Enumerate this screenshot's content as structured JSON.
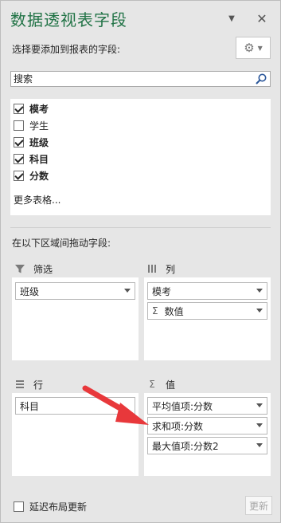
{
  "pane": {
    "title": "数据透视表字段",
    "subtitle": "选择要添加到报表的字段:",
    "title_color": "#217346"
  },
  "search": {
    "placeholder": "搜索"
  },
  "fields": [
    {
      "label": "模考",
      "checked": true,
      "bold": true
    },
    {
      "label": "学生",
      "checked": false,
      "bold": false
    },
    {
      "label": "班级",
      "checked": true,
      "bold": true
    },
    {
      "label": "科目",
      "checked": true,
      "bold": true
    },
    {
      "label": "分数",
      "checked": true,
      "bold": true
    }
  ],
  "more_tables": "更多表格...",
  "drag_hint": "在以下区域间拖动字段:",
  "areas": {
    "filter": {
      "title": "筛选",
      "items": [
        "班级"
      ]
    },
    "columns": {
      "title": "列",
      "items": [
        "模考",
        "数值"
      ]
    },
    "rows": {
      "title": "行",
      "items": [
        "科目"
      ]
    },
    "values": {
      "title": "值",
      "items": [
        "平均值项:分数",
        "求和项:分数",
        "最大值项:分数2"
      ]
    }
  },
  "footer": {
    "defer_label": "延迟布局更新",
    "defer_checked": false,
    "update_label": "更新"
  },
  "annotation_color": "#e8383b"
}
